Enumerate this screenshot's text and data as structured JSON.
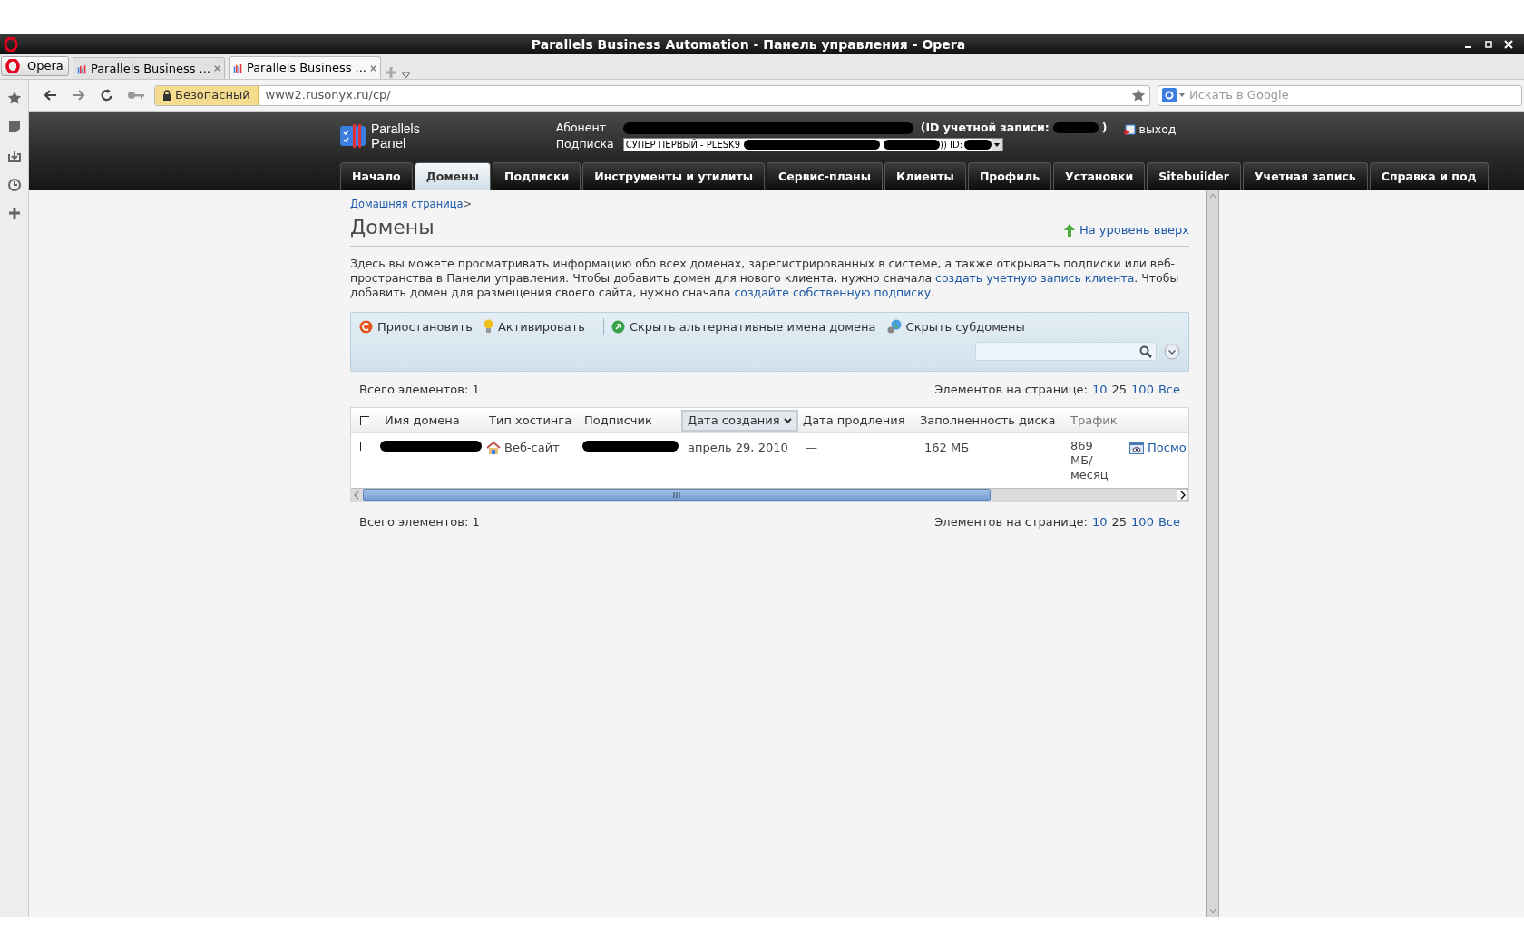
{
  "window": {
    "title": "Parallels Business Automation - Панель управления - Opera"
  },
  "browser": {
    "menu_button": "Opera",
    "tabs": [
      {
        "title": "Parallels Business ...",
        "selected": false
      },
      {
        "title": "Parallels Business ...",
        "selected": true
      }
    ],
    "security_badge": "Безопасный",
    "url": "www2.rusonyx.ru/cp/",
    "search": {
      "placeholder": "Искать в Google"
    }
  },
  "panel_header": {
    "logo_top": "Parallels",
    "logo_bottom": "Panel",
    "subscriber_label": "Абонент",
    "account_id_label": "(ID учетной записи:",
    "account_id_end": ")",
    "subscription_label": "Подписка",
    "subscription_value": "СУПЕР ПЕРВЫЙ - PLESK9",
    "subscription_id_label": ")) ID:",
    "logout": "выход"
  },
  "nav": [
    {
      "label": "Начало",
      "selected": false
    },
    {
      "label": "Домены",
      "selected": true
    },
    {
      "label": "Подписки",
      "selected": false
    },
    {
      "label": "Инструменты и утилиты",
      "selected": false
    },
    {
      "label": "Сервис-планы",
      "selected": false
    },
    {
      "label": "Клиенты",
      "selected": false
    },
    {
      "label": "Профиль",
      "selected": false
    },
    {
      "label": "Установки",
      "selected": false
    },
    {
      "label": "Sitebuilder",
      "selected": false
    },
    {
      "label": "Учетная запись",
      "selected": false
    },
    {
      "label": "Справка и под",
      "selected": false
    }
  ],
  "breadcrumb": {
    "link": "Домашняя страница",
    "separator": ">"
  },
  "page": {
    "title": "Домены",
    "up_link": "На уровень вверх",
    "description": [
      {
        "kind": "text",
        "text": "Здесь вы можете просматривать информацию обо всех доменах, зарегистрированных в системе, а также открывать подписки или веб-пространства в Панели управления. Чтобы добавить домен для нового клиента, нужно сначала "
      },
      {
        "kind": "link",
        "text": "создать учетную запись клиента"
      },
      {
        "kind": "text",
        "text": ". Чтобы добавить домен для размещения своего сайта, нужно сначала "
      },
      {
        "kind": "link",
        "text": "создайте собственную подписку"
      },
      {
        "kind": "text",
        "text": "."
      }
    ]
  },
  "toolbar": {
    "actions": [
      {
        "kind": "suspend",
        "label": "Приостановить"
      },
      {
        "kind": "activate",
        "label": "Активировать"
      },
      {
        "kind": "separator"
      },
      {
        "kind": "aliases",
        "label": "Скрыть альтернативные имена домена"
      },
      {
        "kind": "subdomains",
        "label": "Скрыть субдомены"
      }
    ]
  },
  "summary_top": {
    "total": "Всего элементов: 1",
    "per_page_label": "Элементов на странице:",
    "per_page": [
      {
        "label": "10",
        "selected": false
      },
      {
        "label": "25",
        "selected": true
      },
      {
        "label": "100",
        "selected": false
      },
      {
        "label": "Все",
        "selected": false
      }
    ]
  },
  "table": {
    "header_checked": false,
    "columns": [
      {
        "label": "Имя домена",
        "sorted": false
      },
      {
        "label": "Тип хостинга",
        "sorted": false
      },
      {
        "label": "Подписчик",
        "sorted": false
      },
      {
        "label": "Дата создания",
        "sorted": true
      },
      {
        "label": "Дата продления",
        "sorted": false
      },
      {
        "label": "Заполненность диска",
        "sorted": false
      },
      {
        "label": "Трафик",
        "sorted": false
      }
    ],
    "rows": [
      {
        "checked": false,
        "hosting_type": "Веб-сайт",
        "created": "апрель 29, 2010",
        "renewal": "—",
        "disk": "162 МБ",
        "traffic": "869 МБ/ месяц",
        "action": "Посмо"
      }
    ]
  },
  "summary_bottom": {
    "total": "Всего элементов: 1",
    "per_page_label": "Элементов на странице:",
    "per_page": [
      {
        "label": "10",
        "selected": false
      },
      {
        "label": "25",
        "selected": true
      },
      {
        "label": "100",
        "selected": false
      },
      {
        "label": "Все",
        "selected": false
      }
    ]
  }
}
